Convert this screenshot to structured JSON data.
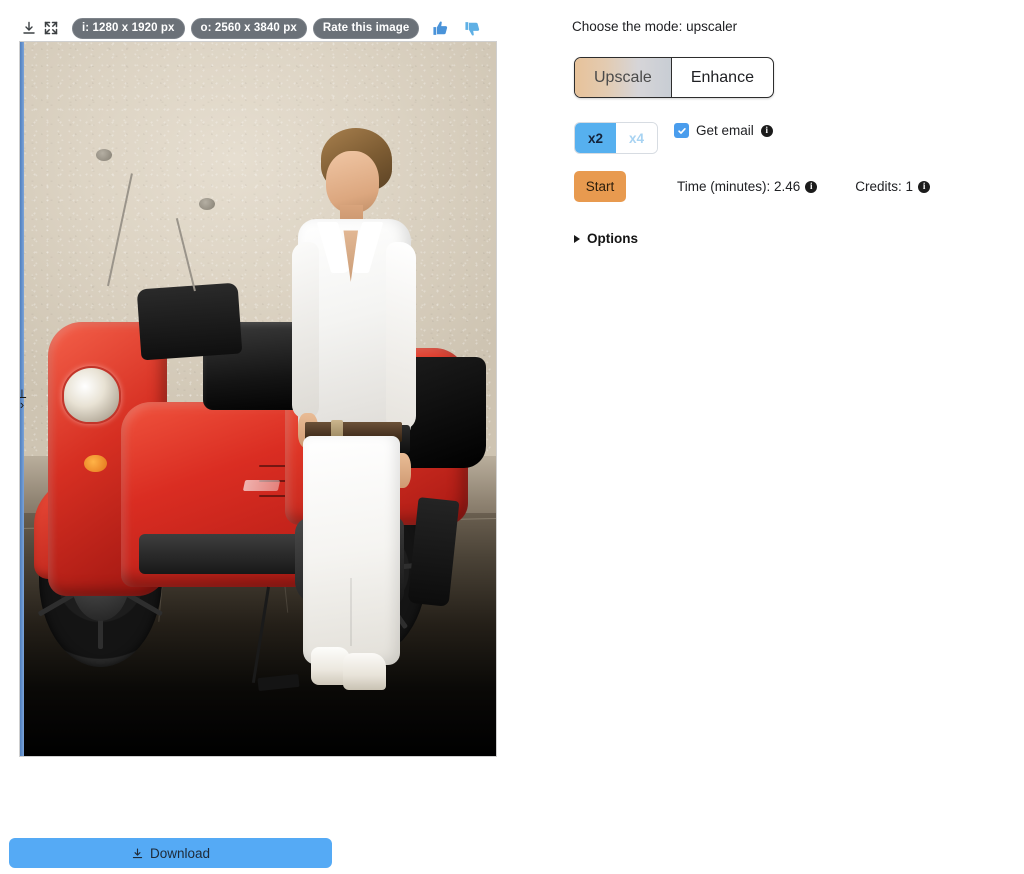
{
  "viewer": {
    "download_icon": "download-icon",
    "fullscreen_icon": "fullscreen-icon",
    "badges": [
      {
        "id": "input-size",
        "label": "i: 1280 x 1920 px"
      },
      {
        "id": "output-size",
        "label": "o: 2560 x 3840 px"
      },
      {
        "id": "rate",
        "label": "Rate this image"
      }
    ],
    "thumb_up_icon": "thumbs-up-icon",
    "thumb_down_icon": "thumbs-down-icon",
    "image_alt": "Young man in white shirt and white trousers leaning against a red scooter in front of a beige stucco wall",
    "compare_handle": "compare-slider-handle"
  },
  "download": {
    "label": "Download",
    "icon": "download-icon",
    "color": "#55aaf5"
  },
  "panel": {
    "mode_label": "Choose the mode: upscaler",
    "mode_options": [
      {
        "id": "upscale",
        "label": "Upscale",
        "selected": true
      },
      {
        "id": "enhance",
        "label": "Enhance",
        "selected": false
      }
    ],
    "scale_options": [
      {
        "id": "x2",
        "label": "x2",
        "selected": true
      },
      {
        "id": "x4",
        "label": "x4",
        "selected": false
      }
    ],
    "get_email": {
      "label": "Get email",
      "checked": true,
      "info_icon": "info-icon"
    },
    "start_label": "Start",
    "time_label": "Time (minutes): 2.46",
    "credits_label": "Credits: 1",
    "options_label": "Options",
    "options_expanded": false,
    "colors": {
      "start_button": "#e89a4f",
      "scale_active": "#56b0ef",
      "checkbox": "#4a9ded",
      "badge": "#6b7178"
    }
  }
}
